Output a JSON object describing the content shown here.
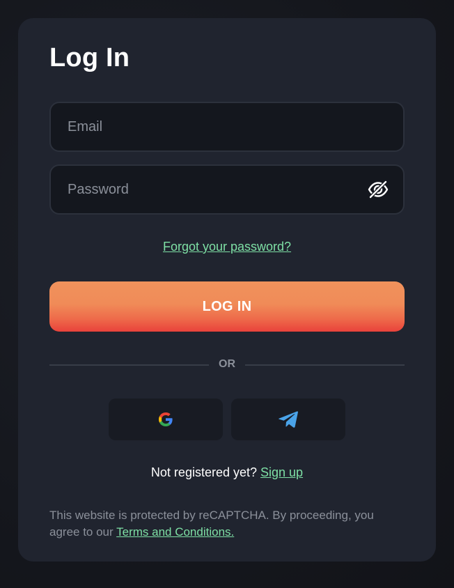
{
  "login": {
    "title": "Log In",
    "email_placeholder": "Email",
    "password_placeholder": "Password",
    "forgot_password": "Forgot your password?",
    "login_button": "LOG IN",
    "divider_text": "OR",
    "social": [
      {
        "name": "Google",
        "icon": "google-icon"
      },
      {
        "name": "Telegram",
        "icon": "telegram-icon"
      }
    ],
    "signup_prompt": "Not registered yet?",
    "signup_link": "Sign up",
    "legal_text": "This website is protected by reCAPTCHA. By proceeding, you agree to our",
    "terms_link": "Terms and Conditions."
  },
  "colors": {
    "card_bg": "#20242f",
    "input_bg": "#14171e",
    "link": "#7ee0a5",
    "button_top": "#f0925c",
    "button_bottom": "#e9423b"
  }
}
